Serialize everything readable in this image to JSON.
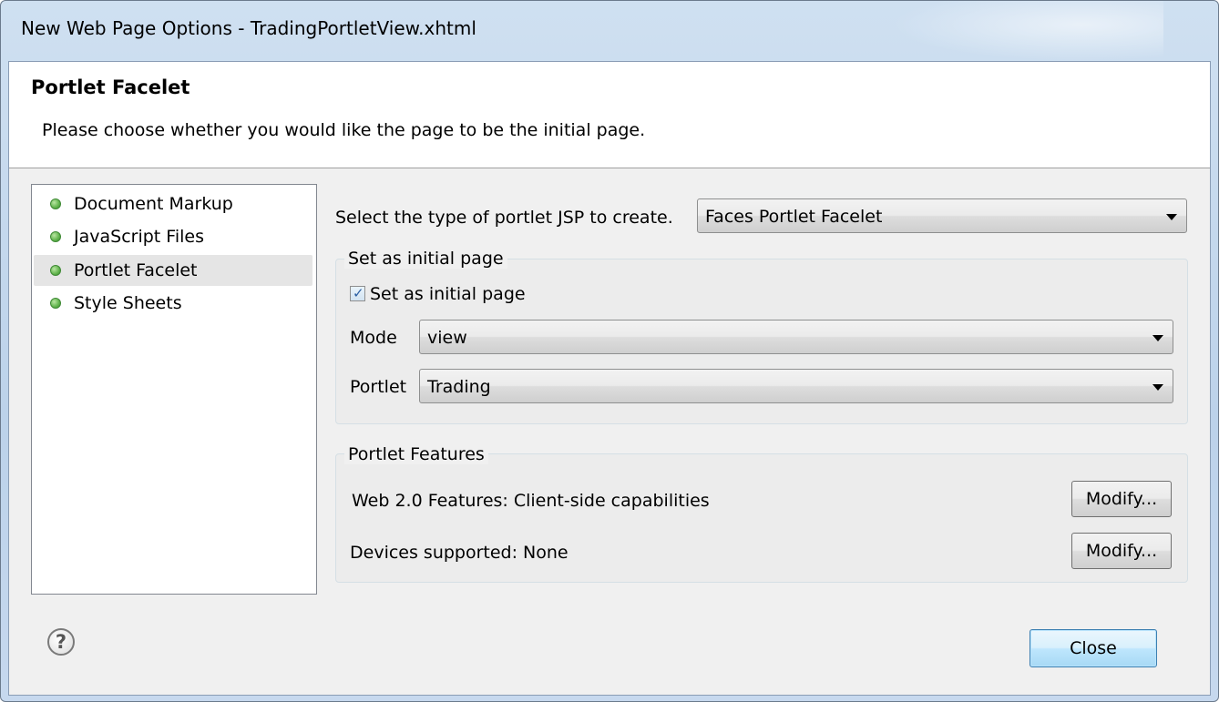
{
  "window": {
    "title": "New Web Page Options - TradingPortletView.xhtml"
  },
  "header": {
    "title": "Portlet Facelet",
    "description": "Please choose whether you would like the page to be the initial page."
  },
  "sidebar": {
    "items": [
      {
        "label": "Document Markup",
        "selected": false
      },
      {
        "label": "JavaScript Files",
        "selected": false
      },
      {
        "label": "Portlet Facelet",
        "selected": true
      },
      {
        "label": "Style Sheets",
        "selected": false
      }
    ]
  },
  "main": {
    "type_label": "Select the type of portlet JSP to create.",
    "type_value": "Faces Portlet Facelet",
    "initial_group": {
      "legend": "Set as initial page",
      "checkbox_label": "Set as initial page",
      "checked": true,
      "mode_label": "Mode",
      "mode_value": "view",
      "portlet_label": "Portlet",
      "portlet_value": "Trading"
    },
    "features_group": {
      "legend": "Portlet Features",
      "web20_label": "Web 2.0 Features: Client-side capabilities",
      "web20_button": "Modify...",
      "devices_label": "Devices supported: None",
      "devices_button": "Modify..."
    }
  },
  "footer": {
    "help_icon": "?",
    "close_label": "Close"
  },
  "colors": {
    "status_dot": "#5fb24b",
    "default_button": "#bee6fd"
  }
}
